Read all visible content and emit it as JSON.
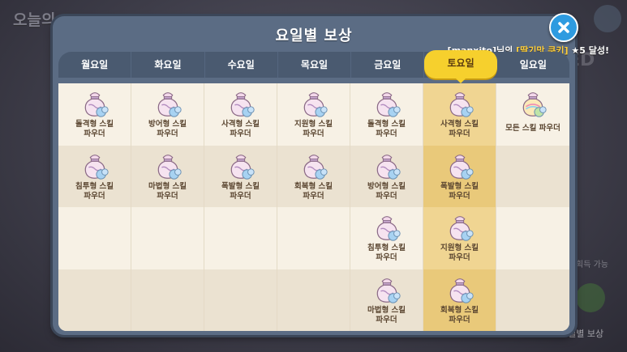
{
  "background": {
    "title": "오늘의 ",
    "badge": "ED",
    "text1": "획득 가능",
    "text2": "요일별 보상"
  },
  "dialog": {
    "title": "요일별 보상",
    "achievement": {
      "user": "[manxito]",
      "suffix1": "님의 ",
      "cookie": "[딸기맛 쿠키]",
      "suffix2": " ★5 달성!"
    }
  },
  "tabs": [
    "월요일",
    "화요일",
    "수요일",
    "목요일",
    "금요일",
    "토요일",
    "일요일"
  ],
  "active_tab_index": 5,
  "schedule": [
    {
      "day": "월요일",
      "items": [
        {
          "label": "돌격형 스킬\n파우더",
          "icon": "potion-bag-icon"
        },
        {
          "label": "침투형 스킬\n파우더",
          "icon": "potion-bag-icon"
        }
      ]
    },
    {
      "day": "화요일",
      "items": [
        {
          "label": "방어형 스킬\n파우더",
          "icon": "potion-bag-icon"
        },
        {
          "label": "마법형 스킬\n파우더",
          "icon": "potion-bag-icon"
        }
      ]
    },
    {
      "day": "수요일",
      "items": [
        {
          "label": "사격형 스킬\n파우더",
          "icon": "potion-bag-icon"
        },
        {
          "label": "폭발형 스킬\n파우더",
          "icon": "potion-bag-icon"
        }
      ]
    },
    {
      "day": "목요일",
      "items": [
        {
          "label": "지원형 스킬\n파우더",
          "icon": "potion-bag-icon"
        },
        {
          "label": "회복형 스킬\n파우더",
          "icon": "potion-bag-icon"
        }
      ]
    },
    {
      "day": "금요일",
      "items": [
        {
          "label": "돌격형 스킬\n파우더",
          "icon": "potion-bag-icon"
        },
        {
          "label": "방어형 스킬\n파우더",
          "icon": "potion-bag-icon"
        },
        {
          "label": "침투형 스킬\n파우더",
          "icon": "potion-bag-icon"
        },
        {
          "label": "마법형 스킬\n파우더",
          "icon": "potion-bag-icon"
        }
      ]
    },
    {
      "day": "토요일",
      "items": [
        {
          "label": "사격형 스킬\n파우더",
          "icon": "potion-bag-icon"
        },
        {
          "label": "폭발형 스킬\n파우더",
          "icon": "potion-bag-icon"
        },
        {
          "label": "지원형 스킬\n파우더",
          "icon": "potion-bag-icon"
        },
        {
          "label": "회복형 스킬\n파우더",
          "icon": "potion-bag-icon"
        }
      ]
    },
    {
      "day": "일요일",
      "items": [
        {
          "label": "모든 스킬 파우더",
          "icon": "rainbow-potion-bag-icon"
        }
      ]
    }
  ],
  "colors": {
    "accent": "#f6d02d",
    "dialog": "#5b6c84",
    "close": "#2e9be0",
    "highlight_text": "#ffcf3c"
  }
}
